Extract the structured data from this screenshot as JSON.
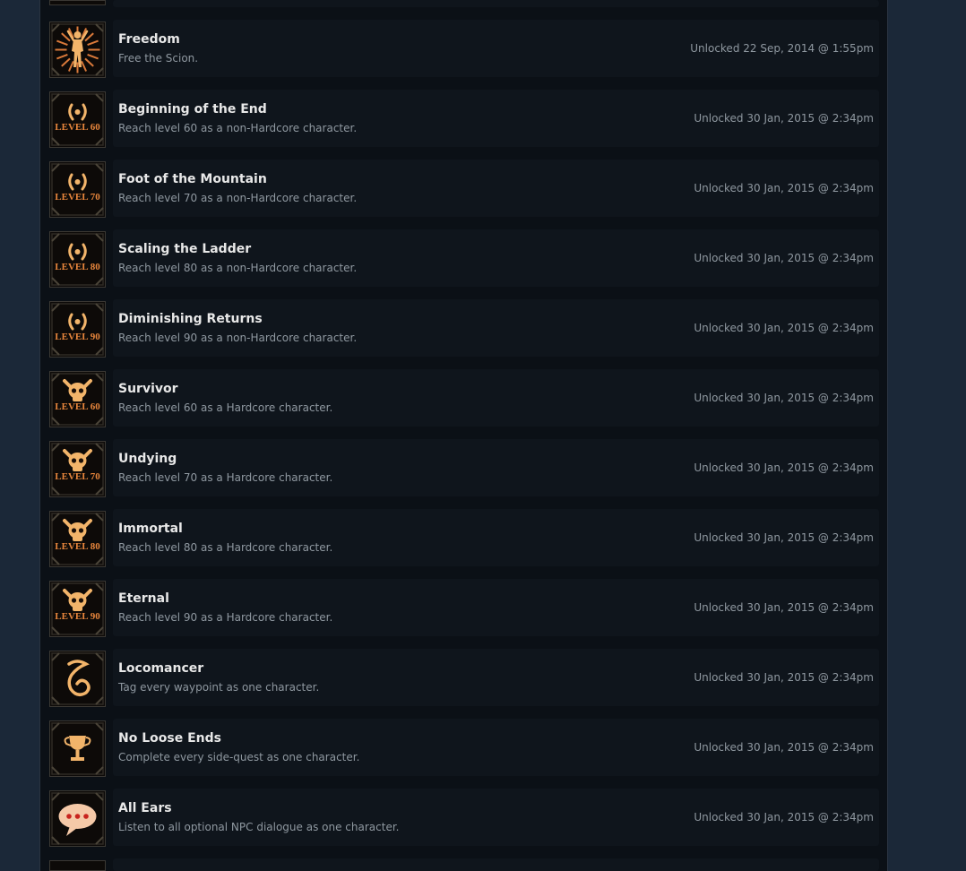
{
  "achievements": [
    {
      "icon": "scion-figure-icon",
      "title": "Freedom",
      "description": "Free the Scion.",
      "unlocked": "Unlocked 22 Sep, 2014 @ 1:55pm"
    },
    {
      "icon": "laurel-level-icon",
      "level_text": "LEVEL 60",
      "title": "Beginning of the End",
      "description": "Reach level 60 as a non-Hardcore character.",
      "unlocked": "Unlocked 30 Jan, 2015 @ 2:34pm"
    },
    {
      "icon": "laurel-level-icon",
      "level_text": "LEVEL 70",
      "title": "Foot of the Mountain",
      "description": "Reach level 70 as a non-Hardcore character.",
      "unlocked": "Unlocked 30 Jan, 2015 @ 2:34pm"
    },
    {
      "icon": "laurel-level-icon",
      "level_text": "LEVEL 80",
      "title": "Scaling the Ladder",
      "description": "Reach level 80 as a non-Hardcore character.",
      "unlocked": "Unlocked 30 Jan, 2015 @ 2:34pm"
    },
    {
      "icon": "laurel-level-icon",
      "level_text": "LEVEL 90",
      "title": "Diminishing Returns",
      "description": "Reach level 90 as a non-Hardcore character.",
      "unlocked": "Unlocked 30 Jan, 2015 @ 2:34pm"
    },
    {
      "icon": "skull-level-icon",
      "level_text": "LEVEL 60",
      "title": "Survivor",
      "description": "Reach level 60 as a Hardcore character.",
      "unlocked": "Unlocked 30 Jan, 2015 @ 2:34pm"
    },
    {
      "icon": "skull-level-icon",
      "level_text": "LEVEL 70",
      "title": "Undying",
      "description": "Reach level 70 as a Hardcore character.",
      "unlocked": "Unlocked 30 Jan, 2015 @ 2:34pm"
    },
    {
      "icon": "skull-level-icon",
      "level_text": "LEVEL 80",
      "title": "Immortal",
      "description": "Reach level 80 as a Hardcore character.",
      "unlocked": "Unlocked 30 Jan, 2015 @ 2:34pm"
    },
    {
      "icon": "skull-level-icon",
      "level_text": "LEVEL 90",
      "title": "Eternal",
      "description": "Reach level 90 as a Hardcore character.",
      "unlocked": "Unlocked 30 Jan, 2015 @ 2:34pm"
    },
    {
      "icon": "waypoint-swirl-icon",
      "title": "Locomancer",
      "description": "Tag every waypoint as one character.",
      "unlocked": "Unlocked 30 Jan, 2015 @ 2:34pm"
    },
    {
      "icon": "trophy-icon",
      "title": "No Loose Ends",
      "description": "Complete every side-quest as one character.",
      "unlocked": "Unlocked 30 Jan, 2015 @ 2:34pm"
    },
    {
      "icon": "speech-bubble-icon",
      "title": "All Ears",
      "description": "Listen to all optional NPC dialogue as one character.",
      "unlocked": "Unlocked 30 Jan, 2015 @ 2:34pm"
    }
  ],
  "colors": {
    "page_background": "#1b2838",
    "panel_background": "#0b1016",
    "card_background": "#0f151c",
    "title_text": "#e8e8e8",
    "secondary_text": "#8f98a0",
    "icon_gold": "#f2b46a",
    "icon_dark": "#0d0a08"
  }
}
